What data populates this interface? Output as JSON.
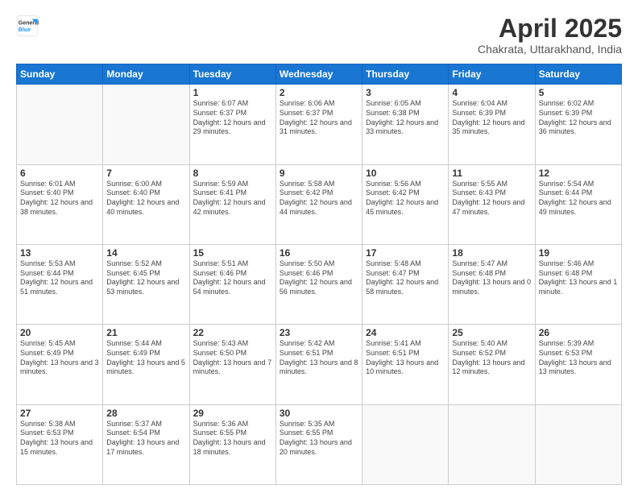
{
  "header": {
    "logo_general": "General",
    "logo_blue": "Blue",
    "title": "April 2025",
    "subtitle": "Chakrata, Uttarakhand, India"
  },
  "days_of_week": [
    "Sunday",
    "Monday",
    "Tuesday",
    "Wednesday",
    "Thursday",
    "Friday",
    "Saturday"
  ],
  "weeks": [
    [
      {
        "day": "",
        "info": ""
      },
      {
        "day": "",
        "info": ""
      },
      {
        "day": "1",
        "info": "Sunrise: 6:07 AM\nSunset: 6:37 PM\nDaylight: 12 hours and 29 minutes."
      },
      {
        "day": "2",
        "info": "Sunrise: 6:06 AM\nSunset: 6:37 PM\nDaylight: 12 hours and 31 minutes."
      },
      {
        "day": "3",
        "info": "Sunrise: 6:05 AM\nSunset: 6:38 PM\nDaylight: 12 hours and 33 minutes."
      },
      {
        "day": "4",
        "info": "Sunrise: 6:04 AM\nSunset: 6:39 PM\nDaylight: 12 hours and 35 minutes."
      },
      {
        "day": "5",
        "info": "Sunrise: 6:02 AM\nSunset: 6:39 PM\nDaylight: 12 hours and 36 minutes."
      }
    ],
    [
      {
        "day": "6",
        "info": "Sunrise: 6:01 AM\nSunset: 6:40 PM\nDaylight: 12 hours and 38 minutes."
      },
      {
        "day": "7",
        "info": "Sunrise: 6:00 AM\nSunset: 6:40 PM\nDaylight: 12 hours and 40 minutes."
      },
      {
        "day": "8",
        "info": "Sunrise: 5:59 AM\nSunset: 6:41 PM\nDaylight: 12 hours and 42 minutes."
      },
      {
        "day": "9",
        "info": "Sunrise: 5:58 AM\nSunset: 6:42 PM\nDaylight: 12 hours and 44 minutes."
      },
      {
        "day": "10",
        "info": "Sunrise: 5:56 AM\nSunset: 6:42 PM\nDaylight: 12 hours and 45 minutes."
      },
      {
        "day": "11",
        "info": "Sunrise: 5:55 AM\nSunset: 6:43 PM\nDaylight: 12 hours and 47 minutes."
      },
      {
        "day": "12",
        "info": "Sunrise: 5:54 AM\nSunset: 6:44 PM\nDaylight: 12 hours and 49 minutes."
      }
    ],
    [
      {
        "day": "13",
        "info": "Sunrise: 5:53 AM\nSunset: 6:44 PM\nDaylight: 12 hours and 51 minutes."
      },
      {
        "day": "14",
        "info": "Sunrise: 5:52 AM\nSunset: 6:45 PM\nDaylight: 12 hours and 53 minutes."
      },
      {
        "day": "15",
        "info": "Sunrise: 5:51 AM\nSunset: 6:46 PM\nDaylight: 12 hours and 54 minutes."
      },
      {
        "day": "16",
        "info": "Sunrise: 5:50 AM\nSunset: 6:46 PM\nDaylight: 12 hours and 56 minutes."
      },
      {
        "day": "17",
        "info": "Sunrise: 5:48 AM\nSunset: 6:47 PM\nDaylight: 12 hours and 58 minutes."
      },
      {
        "day": "18",
        "info": "Sunrise: 5:47 AM\nSunset: 6:48 PM\nDaylight: 13 hours and 0 minutes."
      },
      {
        "day": "19",
        "info": "Sunrise: 5:46 AM\nSunset: 6:48 PM\nDaylight: 13 hours and 1 minute."
      }
    ],
    [
      {
        "day": "20",
        "info": "Sunrise: 5:45 AM\nSunset: 6:49 PM\nDaylight: 13 hours and 3 minutes."
      },
      {
        "day": "21",
        "info": "Sunrise: 5:44 AM\nSunset: 6:49 PM\nDaylight: 13 hours and 5 minutes."
      },
      {
        "day": "22",
        "info": "Sunrise: 5:43 AM\nSunset: 6:50 PM\nDaylight: 13 hours and 7 minutes."
      },
      {
        "day": "23",
        "info": "Sunrise: 5:42 AM\nSunset: 6:51 PM\nDaylight: 13 hours and 8 minutes."
      },
      {
        "day": "24",
        "info": "Sunrise: 5:41 AM\nSunset: 6:51 PM\nDaylight: 13 hours and 10 minutes."
      },
      {
        "day": "25",
        "info": "Sunrise: 5:40 AM\nSunset: 6:52 PM\nDaylight: 13 hours and 12 minutes."
      },
      {
        "day": "26",
        "info": "Sunrise: 5:39 AM\nSunset: 6:53 PM\nDaylight: 13 hours and 13 minutes."
      }
    ],
    [
      {
        "day": "27",
        "info": "Sunrise: 5:38 AM\nSunset: 6:53 PM\nDaylight: 13 hours and 15 minutes."
      },
      {
        "day": "28",
        "info": "Sunrise: 5:37 AM\nSunset: 6:54 PM\nDaylight: 13 hours and 17 minutes."
      },
      {
        "day": "29",
        "info": "Sunrise: 5:36 AM\nSunset: 6:55 PM\nDaylight: 13 hours and 18 minutes."
      },
      {
        "day": "30",
        "info": "Sunrise: 5:35 AM\nSunset: 6:55 PM\nDaylight: 13 hours and 20 minutes."
      },
      {
        "day": "",
        "info": ""
      },
      {
        "day": "",
        "info": ""
      },
      {
        "day": "",
        "info": ""
      }
    ]
  ]
}
